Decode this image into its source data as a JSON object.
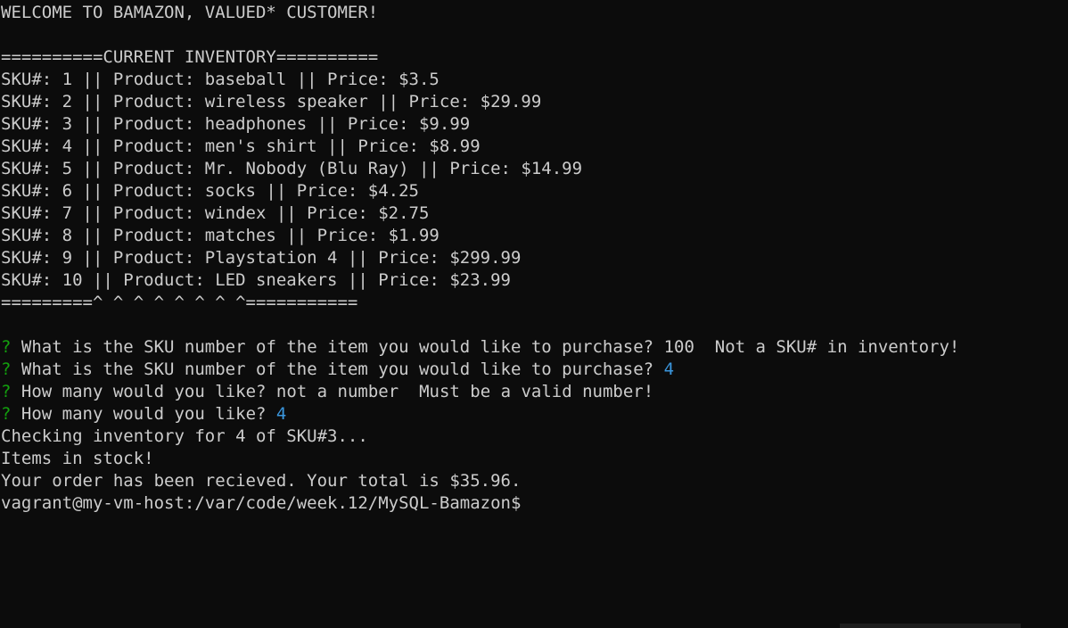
{
  "welcome": "WELCOME TO BAMAZON, VALUED* CUSTOMER!",
  "inventory_header": "==========CURRENT INVENTORY==========",
  "inventory": [
    "SKU#: 1 || Product: baseball || Price: $3.5",
    "SKU#: 2 || Product: wireless speaker || Price: $29.99",
    "SKU#: 3 || Product: headphones || Price: $9.99",
    "SKU#: 4 || Product: men's shirt || Price: $8.99",
    "SKU#: 5 || Product: Mr. Nobody (Blu Ray) || Price: $14.99",
    "SKU#: 6 || Product: socks || Price: $4.25",
    "SKU#: 7 || Product: windex || Price: $2.75",
    "SKU#: 8 || Product: matches || Price: $1.99",
    "SKU#: 9 || Product: Playstation 4 || Price: $299.99",
    "SKU#: 10 || Product: LED sneakers || Price: $23.99"
  ],
  "inventory_footer": "=========^ ^ ^ ^ ^ ^ ^ ^===========",
  "prompt_marker": "?",
  "prompts": [
    {
      "question": "What is the SKU number of the item you would like to purchase?",
      "answer": "100",
      "error": "Not a SKU# in inventory!"
    },
    {
      "question": "What is the SKU number of the item you would like to purchase?",
      "answer": "4",
      "error": ""
    },
    {
      "question": "How many would you like?",
      "answer": "not a number",
      "error": "Must be a valid number!"
    },
    {
      "question": "How many would you like?",
      "answer": "4",
      "error": ""
    }
  ],
  "output": [
    "Checking inventory for 4 of SKU#3...",
    "Items in stock!",
    "Your order has been recieved. Your total is $35.96."
  ],
  "shell_prompt": "vagrant@my-vm-host:/var/code/week.12/MySQL-Bamazon$"
}
